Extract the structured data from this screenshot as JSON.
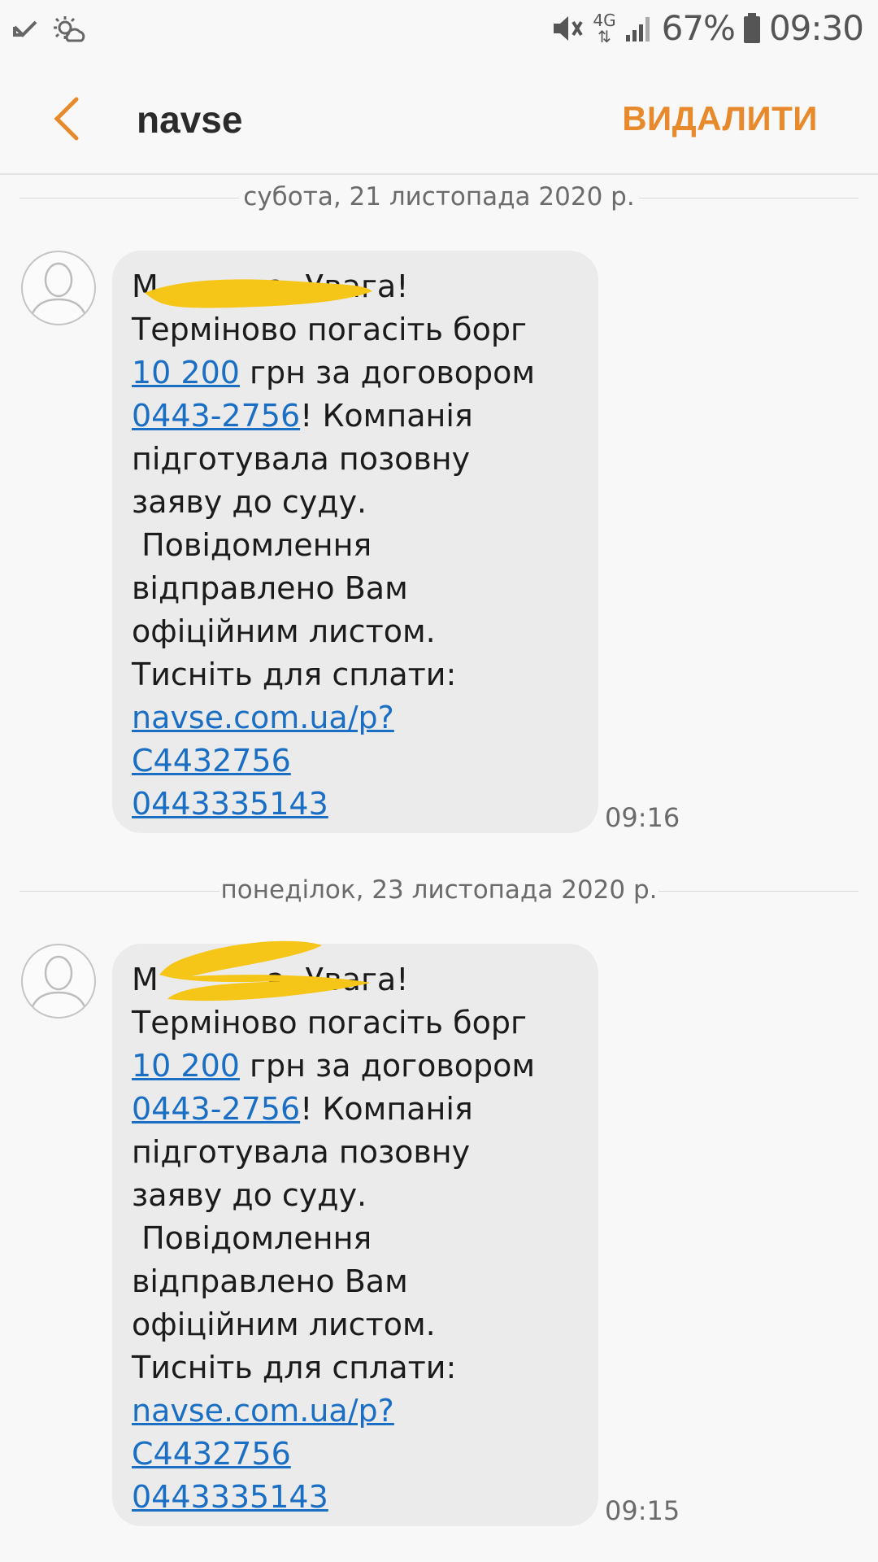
{
  "status_bar": {
    "battery_percent": "67%",
    "clock": "09:30",
    "network": "4G",
    "icons": [
      "missed-call-icon",
      "weather-icon",
      "mute-icon",
      "signal-icon",
      "battery-icon"
    ]
  },
  "header": {
    "title": "navse",
    "delete_label": "ВИДАЛИТИ",
    "accent_color": "#e8892c"
  },
  "conversation": [
    {
      "date": "субота, 21 листопада 2020 р.",
      "time": "09:16",
      "text": {
        "greeting_start": "М",
        "greeting_end": "а, Увага!",
        "line2": "Терміново погасіть борг",
        "amount": "10 200",
        "amount_suffix": " грн за договором",
        "contract": "0443-2756",
        "contract_suffix": "! Компанія",
        "line5": "підготувала позовну",
        "line6": "заяву до суду.",
        "line7": " Повідомлення",
        "line8": "відправлено Вам",
        "line9": "офіційним листом.",
        "line10": "Тисніть для сплати:",
        "link1": "navse.com.ua/p?",
        "link2": "C4432756",
        "phone": "0443335143"
      }
    },
    {
      "date": "понеділок, 23 листопада 2020 р.",
      "time": "09:15",
      "text": {
        "greeting_start": "М",
        "greeting_end": "а, Увага!",
        "line2": "Терміново погасіть борг",
        "amount": "10 200",
        "amount_suffix": " грн за договором",
        "contract": "0443-2756",
        "contract_suffix": "! Компанія",
        "line5": "підготувала позовну",
        "line6": "заяву до суду.",
        "line7": " Повідомлення",
        "line8": "відправлено Вам",
        "line9": "офіційним листом.",
        "line10": "Тисніть для сплати:",
        "link1": "navse.com.ua/p?",
        "link2": "C4432756",
        "phone": "0443335143"
      }
    }
  ],
  "colors": {
    "link": "#1a6fc4",
    "bubble": "#ebebeb",
    "redaction": "#f5c518"
  }
}
